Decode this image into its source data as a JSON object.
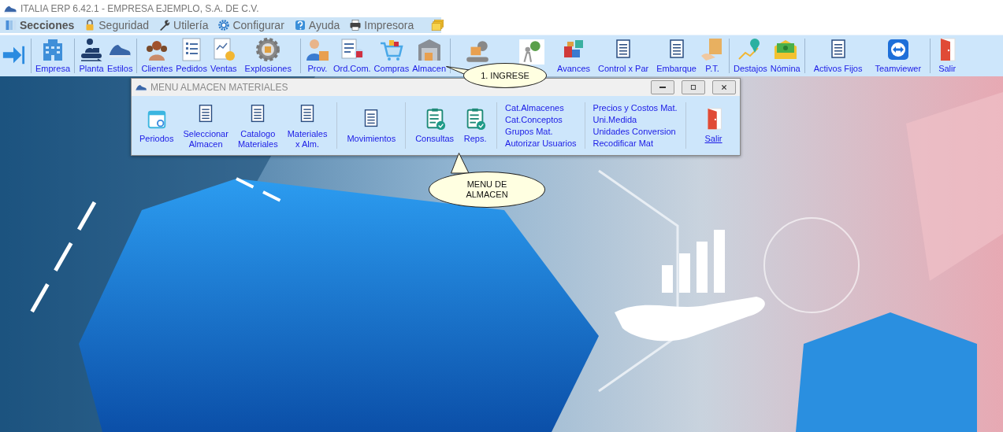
{
  "window": {
    "title": "ITALIA ERP 6.42.1 - EMPRESA EJEMPLO, S.A. DE C.V."
  },
  "menu_bar": [
    {
      "kind": "text",
      "label": "Secciones",
      "selected": true
    },
    {
      "kind": "text",
      "label": "Seguridad",
      "selected": false
    },
    {
      "kind": "text",
      "label": "Utilería",
      "selected": false
    },
    {
      "kind": "text",
      "label": "Configurar",
      "selected": false
    },
    {
      "kind": "text",
      "label": "Ayuda",
      "selected": false
    },
    {
      "kind": "text",
      "label": "Impresora",
      "selected": false
    },
    {
      "kind": "icon",
      "selected": false
    }
  ],
  "toolbar": [
    {
      "kind": "icon"
    },
    {
      "kind": "separator"
    },
    {
      "kind": "button",
      "label": "Empresa"
    },
    {
      "kind": "separator"
    },
    {
      "kind": "button",
      "label": "Planta"
    },
    {
      "kind": "button",
      "label": "Estilos"
    },
    {
      "kind": "separator"
    },
    {
      "kind": "button",
      "label": "Clientes"
    },
    {
      "kind": "button",
      "label": "Pedidos"
    },
    {
      "kind": "button",
      "label": "Ventas"
    },
    {
      "kind": "button",
      "label": "Explosiones"
    },
    {
      "kind": "separator"
    },
    {
      "kind": "button",
      "label": "Prov."
    },
    {
      "kind": "button",
      "label": "Ord.Com."
    },
    {
      "kind": "button",
      "label": "Compras"
    },
    {
      "kind": "button",
      "label": "Almacen"
    },
    {
      "kind": "separator"
    },
    {
      "kind": "icon"
    },
    {
      "kind": "icon"
    },
    {
      "kind": "button",
      "label": "Avances"
    },
    {
      "kind": "button",
      "label": "Control x Par"
    },
    {
      "kind": "button",
      "label": "Embarque"
    },
    {
      "kind": "button",
      "label": "P.T."
    },
    {
      "kind": "separator"
    },
    {
      "kind": "button",
      "label": "Destajos"
    },
    {
      "kind": "button",
      "label": "Nómina"
    },
    {
      "kind": "separator"
    },
    {
      "kind": "button",
      "label": "Activos Fijos"
    },
    {
      "kind": "button",
      "label": "Teamviewer"
    },
    {
      "kind": "separator"
    },
    {
      "kind": "button",
      "label": "Salir"
    }
  ],
  "dialog": {
    "title": "MENU ALMACEN MATERIALES",
    "items": [
      {
        "kind": "button",
        "label": "Periodos"
      },
      {
        "kind": "button",
        "label": "Seleccionar\nAlmacen"
      },
      {
        "kind": "button",
        "label": "Catalogo\nMateriales"
      },
      {
        "kind": "button",
        "label": "Materiales\nx Alm."
      },
      {
        "kind": "separator"
      },
      {
        "kind": "button",
        "label": "Movimientos"
      },
      {
        "kind": "separator"
      },
      {
        "kind": "button",
        "label": "Consultas"
      },
      {
        "kind": "button",
        "label": "Reps."
      },
      {
        "kind": "separator"
      },
      {
        "kind": "links",
        "links": [
          "Cat.Almacenes",
          "Cat.Conceptos",
          "Grupos Mat.",
          "Autorizar Usuarios"
        ]
      },
      {
        "kind": "separator"
      },
      {
        "kind": "links",
        "links": [
          "Precios y Costos Mat.",
          "Uni.Medida",
          "Unidades Conversion",
          "Recodificar Mat"
        ]
      },
      {
        "kind": "separator"
      },
      {
        "kind": "exit",
        "label": "Salir"
      }
    ]
  },
  "callouts": [
    {
      "text": "1. INGRESE"
    },
    {
      "text": "MENU DE\nALMACEN"
    }
  ]
}
